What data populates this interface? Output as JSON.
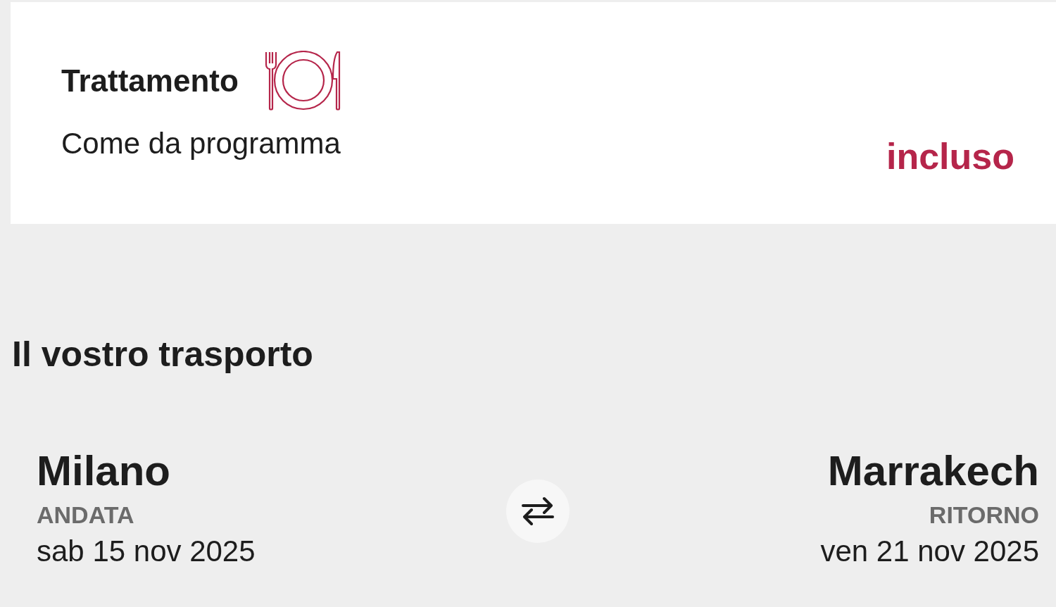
{
  "meal": {
    "title": "Trattamento",
    "description": "Come da programma",
    "price": "incluso"
  },
  "transport": {
    "heading": "Il vostro trasporto",
    "legs": [
      {
        "city": "Milano",
        "label": "ANDATA",
        "date": "sab 15 nov 2025"
      },
      {
        "city": "Marrakech",
        "label": "RITORNO",
        "date": "ven 21 nov 2025"
      }
    ]
  }
}
